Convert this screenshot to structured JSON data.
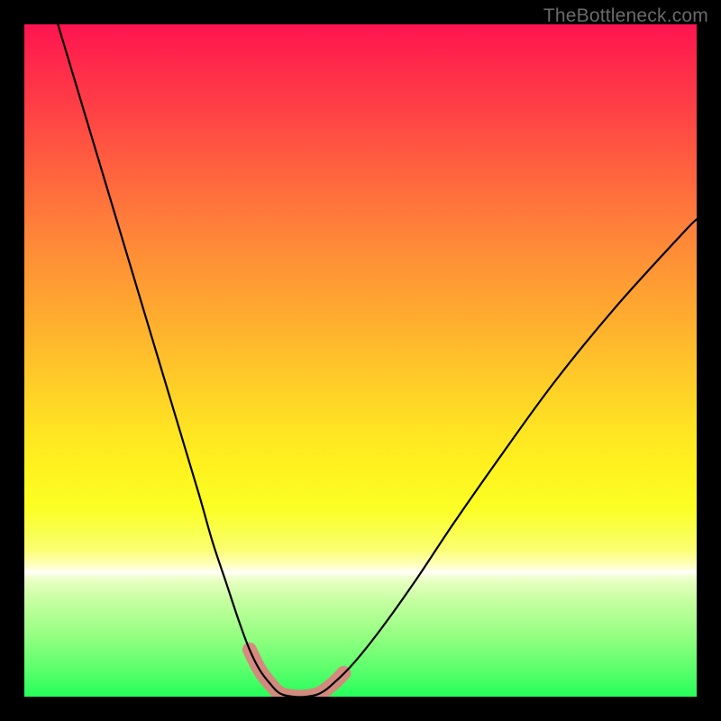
{
  "watermark": "TheBottleneck.com",
  "colors": {
    "frame": "#000000",
    "gradient_top": "#ff1450",
    "gradient_mid": "#ffe323",
    "gradient_bottom": "#25ff5a",
    "curve": "#000000",
    "highlight": "#e08080"
  },
  "chart_data": {
    "type": "line",
    "title": "",
    "xlabel": "",
    "ylabel": "",
    "xlim": [
      0,
      100
    ],
    "ylim": [
      0,
      100
    ],
    "grid": false,
    "legend": false,
    "series": [
      {
        "name": "left-curve",
        "x": [
          5,
          8,
          11,
          14,
          17,
          20,
          23,
          26,
          28,
          30,
          32,
          33.5,
          35,
          36.5,
          38
        ],
        "y": [
          100,
          90,
          80,
          70,
          60,
          50,
          40,
          30,
          23,
          17,
          11,
          7,
          4,
          2,
          0.5
        ]
      },
      {
        "name": "trough",
        "x": [
          38,
          40,
          42,
          44
        ],
        "y": [
          0.5,
          0,
          0,
          0.5
        ]
      },
      {
        "name": "right-curve",
        "x": [
          44,
          46,
          49,
          53,
          58,
          64,
          71,
          79,
          88,
          98,
          100
        ],
        "y": [
          0.5,
          2,
          5,
          10,
          17,
          26,
          36,
          47,
          58,
          69,
          71
        ]
      },
      {
        "name": "highlight-zone",
        "x": [
          33.5,
          35,
          36.5,
          38,
          40,
          42,
          44,
          46,
          47.5
        ],
        "y": [
          7,
          4,
          2,
          0.5,
          0,
          0,
          0.5,
          2,
          3.5
        ]
      }
    ]
  }
}
